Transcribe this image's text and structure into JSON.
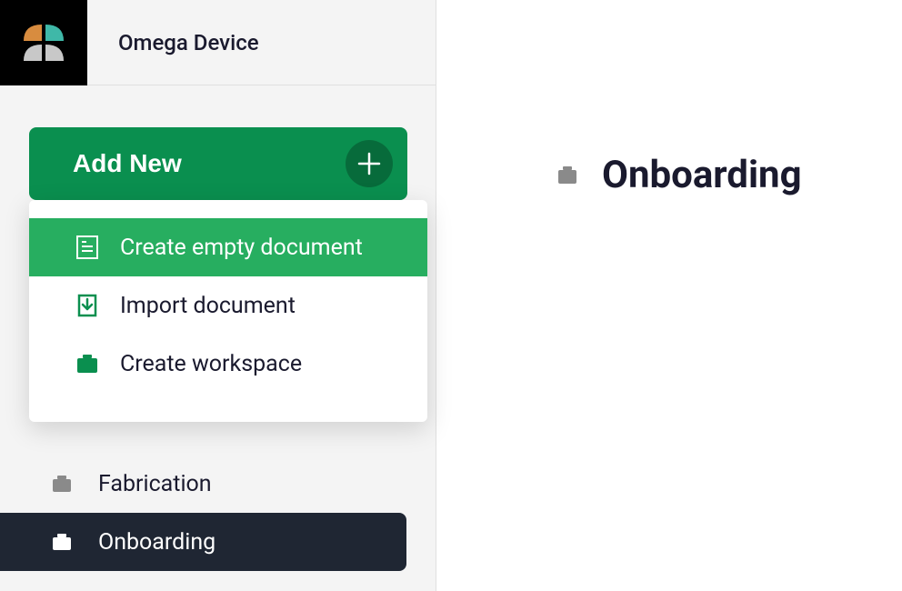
{
  "workspace": {
    "title": "Omega Device"
  },
  "addNew": {
    "label": "Add New"
  },
  "dropdown": {
    "items": [
      {
        "label": "Create empty document",
        "icon": "document-icon"
      },
      {
        "label": "Import document",
        "icon": "import-icon"
      },
      {
        "label": "Create workspace",
        "icon": "briefcase-icon"
      }
    ]
  },
  "nav": {
    "items": [
      {
        "label": "Fabrication",
        "active": false
      },
      {
        "label": "Onboarding",
        "active": true
      }
    ]
  },
  "page": {
    "title": "Onboarding"
  },
  "colors": {
    "brand_green": "#0a8f4f",
    "active_green": "#27ae60",
    "dark_nav": "#1f2633",
    "logo_teal": "#3fb8a8",
    "logo_orange": "#d88c3f",
    "logo_gray": "#c8c8c8"
  }
}
